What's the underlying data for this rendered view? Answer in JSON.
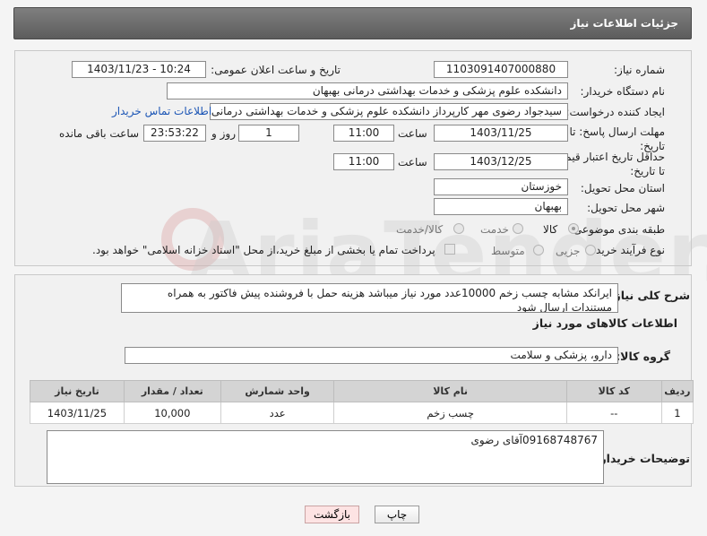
{
  "header": {
    "title": "جزئیات اطلاعات نیاز"
  },
  "watermark": "AriaTender.net",
  "fields": {
    "need_number_label": "شماره نیاز:",
    "need_number": "1103091407000880",
    "announce_label": "تاریخ و ساعت اعلان عمومی:",
    "announce_value": "1403/11/23 - 10:24",
    "buyer_label": "نام دستگاه خریدار:",
    "buyer_value": "دانشکده علوم پزشکی و خدمات بهداشتی  درمانی بهبهان",
    "creator_label": "ایجاد کننده درخواست:",
    "creator_value": "سیدجواد رضوی مهر کارپرداز دانشکده علوم پزشکی و خدمات بهداشتی  درمانی بهبهان",
    "contact_link": "اطلاعات تماس خریدار",
    "send_deadline_label": "مهلت ارسال پاسخ: تا تاریخ:",
    "send_date": "1403/11/25",
    "time_label": "ساعت",
    "send_time": "11:00",
    "days_value": "1",
    "days_label": "روز و",
    "remaining_time": "23:53:22",
    "remaining_label": "ساعت باقی مانده",
    "price_deadline_label": "حداقل تاریخ اعتبار قیمت: تا تاریخ:",
    "price_date": "1403/12/25",
    "price_time": "11:00",
    "province_label": "استان محل تحویل:",
    "province_value": "خوزستان",
    "city_label": "شهر محل تحویل:",
    "city_value": "بهبهان",
    "category_label": "طبقه بندی موضوعی:",
    "category_options": [
      "کالا",
      "خدمت",
      "کالا/خدمت"
    ],
    "process_label": "نوع فرآیند خرید :",
    "process_options": [
      "جزیی",
      "متوسط"
    ],
    "payment_note": "پرداخت تمام یا بخشی از مبلغ خرید،از محل \"اسناد خزانه اسلامی\" خواهد بود."
  },
  "details": {
    "desc_label": "شرح کلی نیاز:",
    "desc_value": "ایرانکد مشابه چسب زخم 10000عدد مورد نیاز میباشد هزینه حمل با فروشنده پیش فاکتور به همراه مستندات ارسال شود",
    "goods_info_label": "اطلاعات کالاهای مورد نیاز",
    "goods_group_label": "گروه کالا:",
    "goods_group_value": "دارو، پزشکی و سلامت",
    "table": {
      "headers": [
        "ردیف",
        "کد کالا",
        "نام کالا",
        "واحد شمارش",
        "تعداد / مقدار",
        "تاریخ نیاز"
      ],
      "rows": [
        [
          "1",
          "--",
          "چسب زخم",
          "عدد",
          "10,000",
          "1403/11/25"
        ]
      ]
    },
    "buyer_notes_label": "توضیحات خریدار:",
    "buyer_notes_value": "09168748767آقای رضوی"
  },
  "buttons": {
    "print": "چاپ",
    "back": "بازگشت"
  },
  "colors": {
    "header_bg": "#6b6b6b",
    "link": "#1b55b5",
    "back_bg": "#fde3e3"
  }
}
